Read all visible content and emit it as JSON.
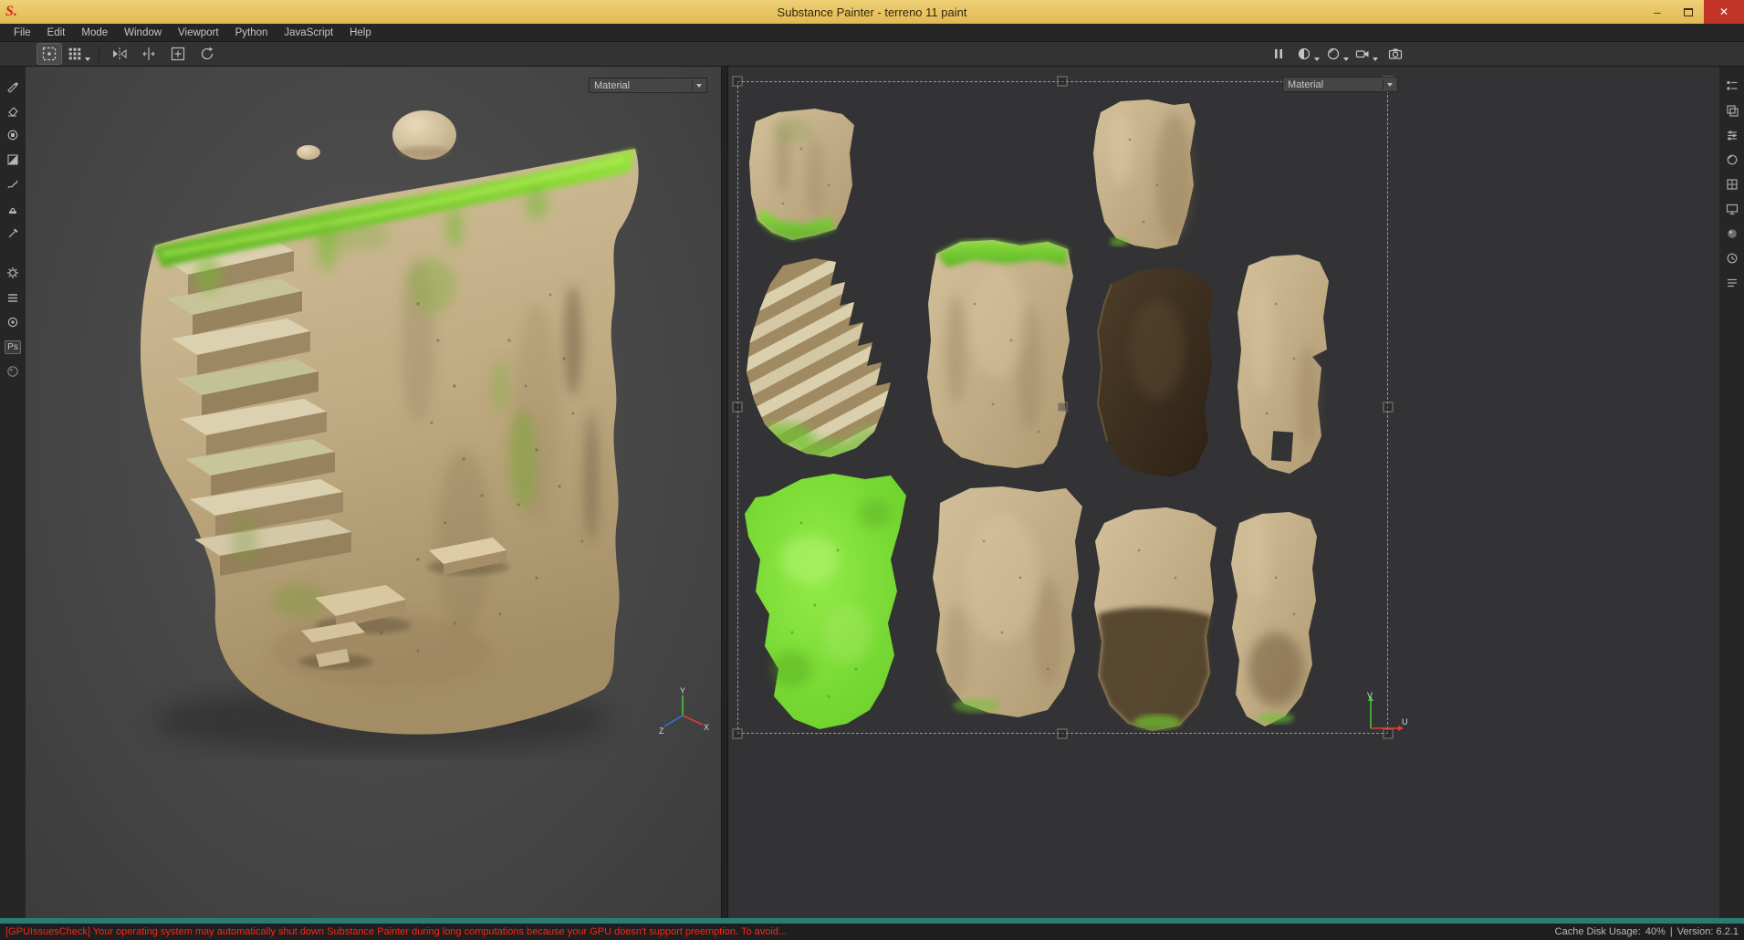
{
  "window": {
    "title": "Substance Painter - terreno 11 paint",
    "logo": "S.",
    "controls": {
      "minimize": "–",
      "close": "✕"
    }
  },
  "menu": {
    "items": [
      "File",
      "Edit",
      "Mode",
      "Window",
      "Viewport",
      "Python",
      "JavaScript",
      "Help"
    ]
  },
  "viewport_3d": {
    "material_selector": "Material",
    "axes": {
      "x": "X",
      "y": "Y",
      "z": "Z"
    }
  },
  "viewport_2d": {
    "material_selector": "Material",
    "axes": {
      "u": "U",
      "v": "V"
    }
  },
  "icons": {
    "photoshop": "Ps",
    "substance": "S"
  },
  "status_bar": {
    "warning": "[GPUIssuesCheck] Your operating system may automatically shut down Substance Painter during long computations because your GPU doesn't support preemption. To avoid...",
    "cache_disk_usage_label": "Cache Disk Usage:",
    "cache_disk_usage_value": "40%",
    "separator": "|",
    "version": "Version: 6.2.1"
  },
  "colors": {
    "titlebar": "#e9c565",
    "close_button": "#c23428",
    "moss_green": "#7ed32e",
    "teal_strip": "#2a7d74",
    "warning_text": "#ff2416"
  }
}
